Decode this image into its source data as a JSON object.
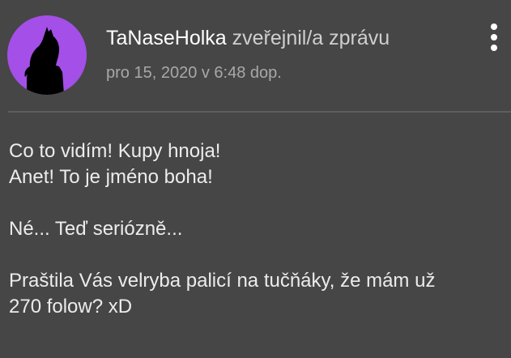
{
  "post": {
    "author_name": "TaNaseHolka",
    "author_action": "zveřejnil/a zprávu",
    "timestamp": "pro 15, 2020 v 6:48 dop.",
    "menu_icon": "more-vertical-icon",
    "avatar_icon": "howling-wolf-silhouette",
    "message": {
      "line1": "Co to vidím! Kupy hnoja!",
      "line2": "Anet! To je jméno boha!",
      "line3": "Né... Teď seriózně...",
      "line4": "Praštila Vás velryba palicí na tučňáky, že mám už",
      "line5": "270 folow? xD"
    }
  },
  "colors": {
    "background": "#464646",
    "avatar_background": "#a44fe8",
    "author_name": "#ffffff",
    "author_action": "#cfcfcf",
    "timestamp": "#a8a8a8",
    "message_text": "#ececec",
    "divider": "#5d5d5d"
  }
}
